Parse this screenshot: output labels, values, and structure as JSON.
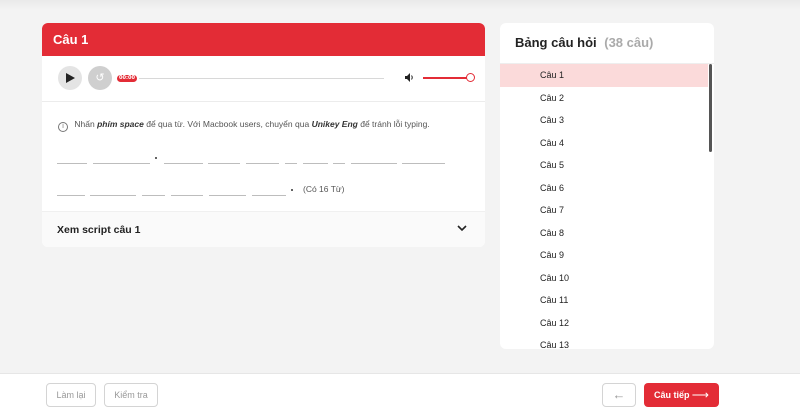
{
  "question": {
    "title": "Câu 1",
    "audio": {
      "time": "00:00"
    },
    "hint": {
      "prefix": "Nhấn",
      "key": "phím space",
      "middle": "để qua từ. Với Macbook users, chuyển qua",
      "ime": "Unikey Eng",
      "suffix": "để tránh lỗi typing."
    },
    "word_count": "(Có 16 Từ)",
    "script_label": "Xem script câu 1"
  },
  "panel": {
    "title": "Bảng câu hỏi",
    "count": "(38 câu)",
    "items": [
      "Câu 1",
      "Câu 2",
      "Câu 3",
      "Câu 4",
      "Câu 5",
      "Câu 6",
      "Câu 7",
      "Câu 8",
      "Câu 9",
      "Câu 10",
      "Câu 11",
      "Câu 12",
      "Câu 13"
    ],
    "active_index": 0
  },
  "footer": {
    "retry_label": "Làm lại",
    "check_label": "Kiểm tra",
    "prev_arrow": "←",
    "next_label": "Câu tiếp",
    "next_arrow": "⟶"
  },
  "colors": {
    "accent": "#e32c36",
    "active_row": "#fbdada"
  },
  "icons": [
    "play-icon",
    "replay-icon",
    "volume-icon",
    "info-icon",
    "chevron-down-icon",
    "arrow-left-icon",
    "arrow-right-icon"
  ]
}
